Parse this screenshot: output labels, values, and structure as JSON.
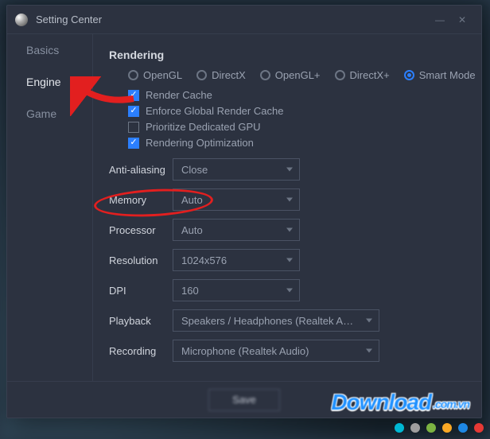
{
  "window": {
    "title": "Setting Center",
    "save_label": "Save"
  },
  "sidebar": {
    "items": [
      {
        "label": "Basics"
      },
      {
        "label": "Engine"
      },
      {
        "label": "Game"
      }
    ],
    "active_index": 1
  },
  "rendering": {
    "section_title": "Rendering",
    "modes": [
      {
        "label": "OpenGL",
        "selected": false
      },
      {
        "label": "DirectX",
        "selected": false
      },
      {
        "label": "OpenGL+",
        "selected": false
      },
      {
        "label": "DirectX+",
        "selected": false
      },
      {
        "label": "Smart Mode",
        "selected": true
      }
    ],
    "checks": [
      {
        "label": "Render Cache",
        "checked": true
      },
      {
        "label": "Enforce Global Render Cache",
        "checked": true
      },
      {
        "label": "Prioritize Dedicated GPU",
        "checked": false
      },
      {
        "label": "Rendering Optimization",
        "checked": true
      }
    ]
  },
  "form": {
    "anti_aliasing": {
      "label": "Anti-aliasing",
      "value": "Close"
    },
    "memory": {
      "label": "Memory",
      "value": "Auto"
    },
    "processor": {
      "label": "Processor",
      "value": "Auto"
    },
    "resolution": {
      "label": "Resolution",
      "value": "1024x576"
    },
    "dpi": {
      "label": "DPI",
      "value": "160"
    },
    "playback": {
      "label": "Playback",
      "value": "Speakers / Headphones (Realtek Audio)"
    },
    "recording": {
      "label": "Recording",
      "value": "Microphone (Realtek Audio)"
    }
  },
  "watermark": {
    "text": "Download",
    "tld": ".com.vn"
  },
  "dots_colors": [
    "#00b8d4",
    "#9e9e9e",
    "#7cb342",
    "#f9a825",
    "#1e88e5",
    "#e53935"
  ]
}
